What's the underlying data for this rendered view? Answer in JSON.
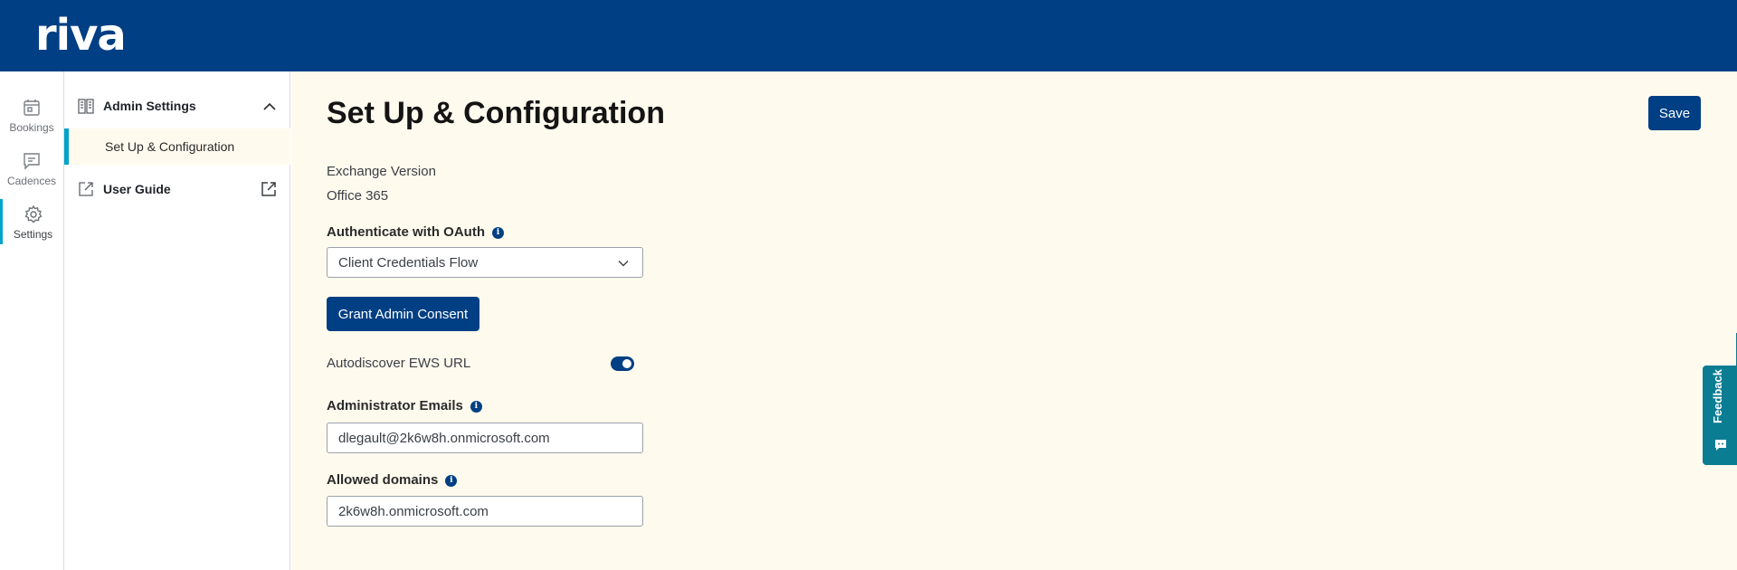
{
  "header": {
    "logo_text": "riva"
  },
  "rail": {
    "items": [
      {
        "label": "Bookings",
        "icon": "calendar-icon"
      },
      {
        "label": "Cadences",
        "icon": "message-icon"
      },
      {
        "label": "Settings",
        "icon": "gear-icon",
        "active": true
      }
    ]
  },
  "sidenav": {
    "section_label": "Admin Settings",
    "sub_item": "Set Up & Configuration",
    "guide_label": "User Guide"
  },
  "main": {
    "title": "Set Up & Configuration",
    "save_label": "Save",
    "exchange_version_label": "Exchange Version",
    "exchange_version_value": "Office 365",
    "oauth_label": "Authenticate with OAuth",
    "oauth_selected": "Client Credentials Flow",
    "grant_label": "Grant Admin Consent",
    "autodiscover_label": "Autodiscover EWS URL",
    "autodiscover_on": true,
    "admin_emails_label": "Administrator Emails",
    "admin_emails_value": "dlegault@2k6w8h.onmicrosoft.com",
    "allowed_domains_label": "Allowed domains",
    "allowed_domains_value": "2k6w8h.onmicrosoft.com",
    "info_glyph": "i"
  },
  "feedback": {
    "label": "Feedback"
  },
  "colors": {
    "header": "#003f83",
    "accent": "#00a3c9",
    "background": "#fffaee",
    "feedback": "#0b7d93"
  }
}
